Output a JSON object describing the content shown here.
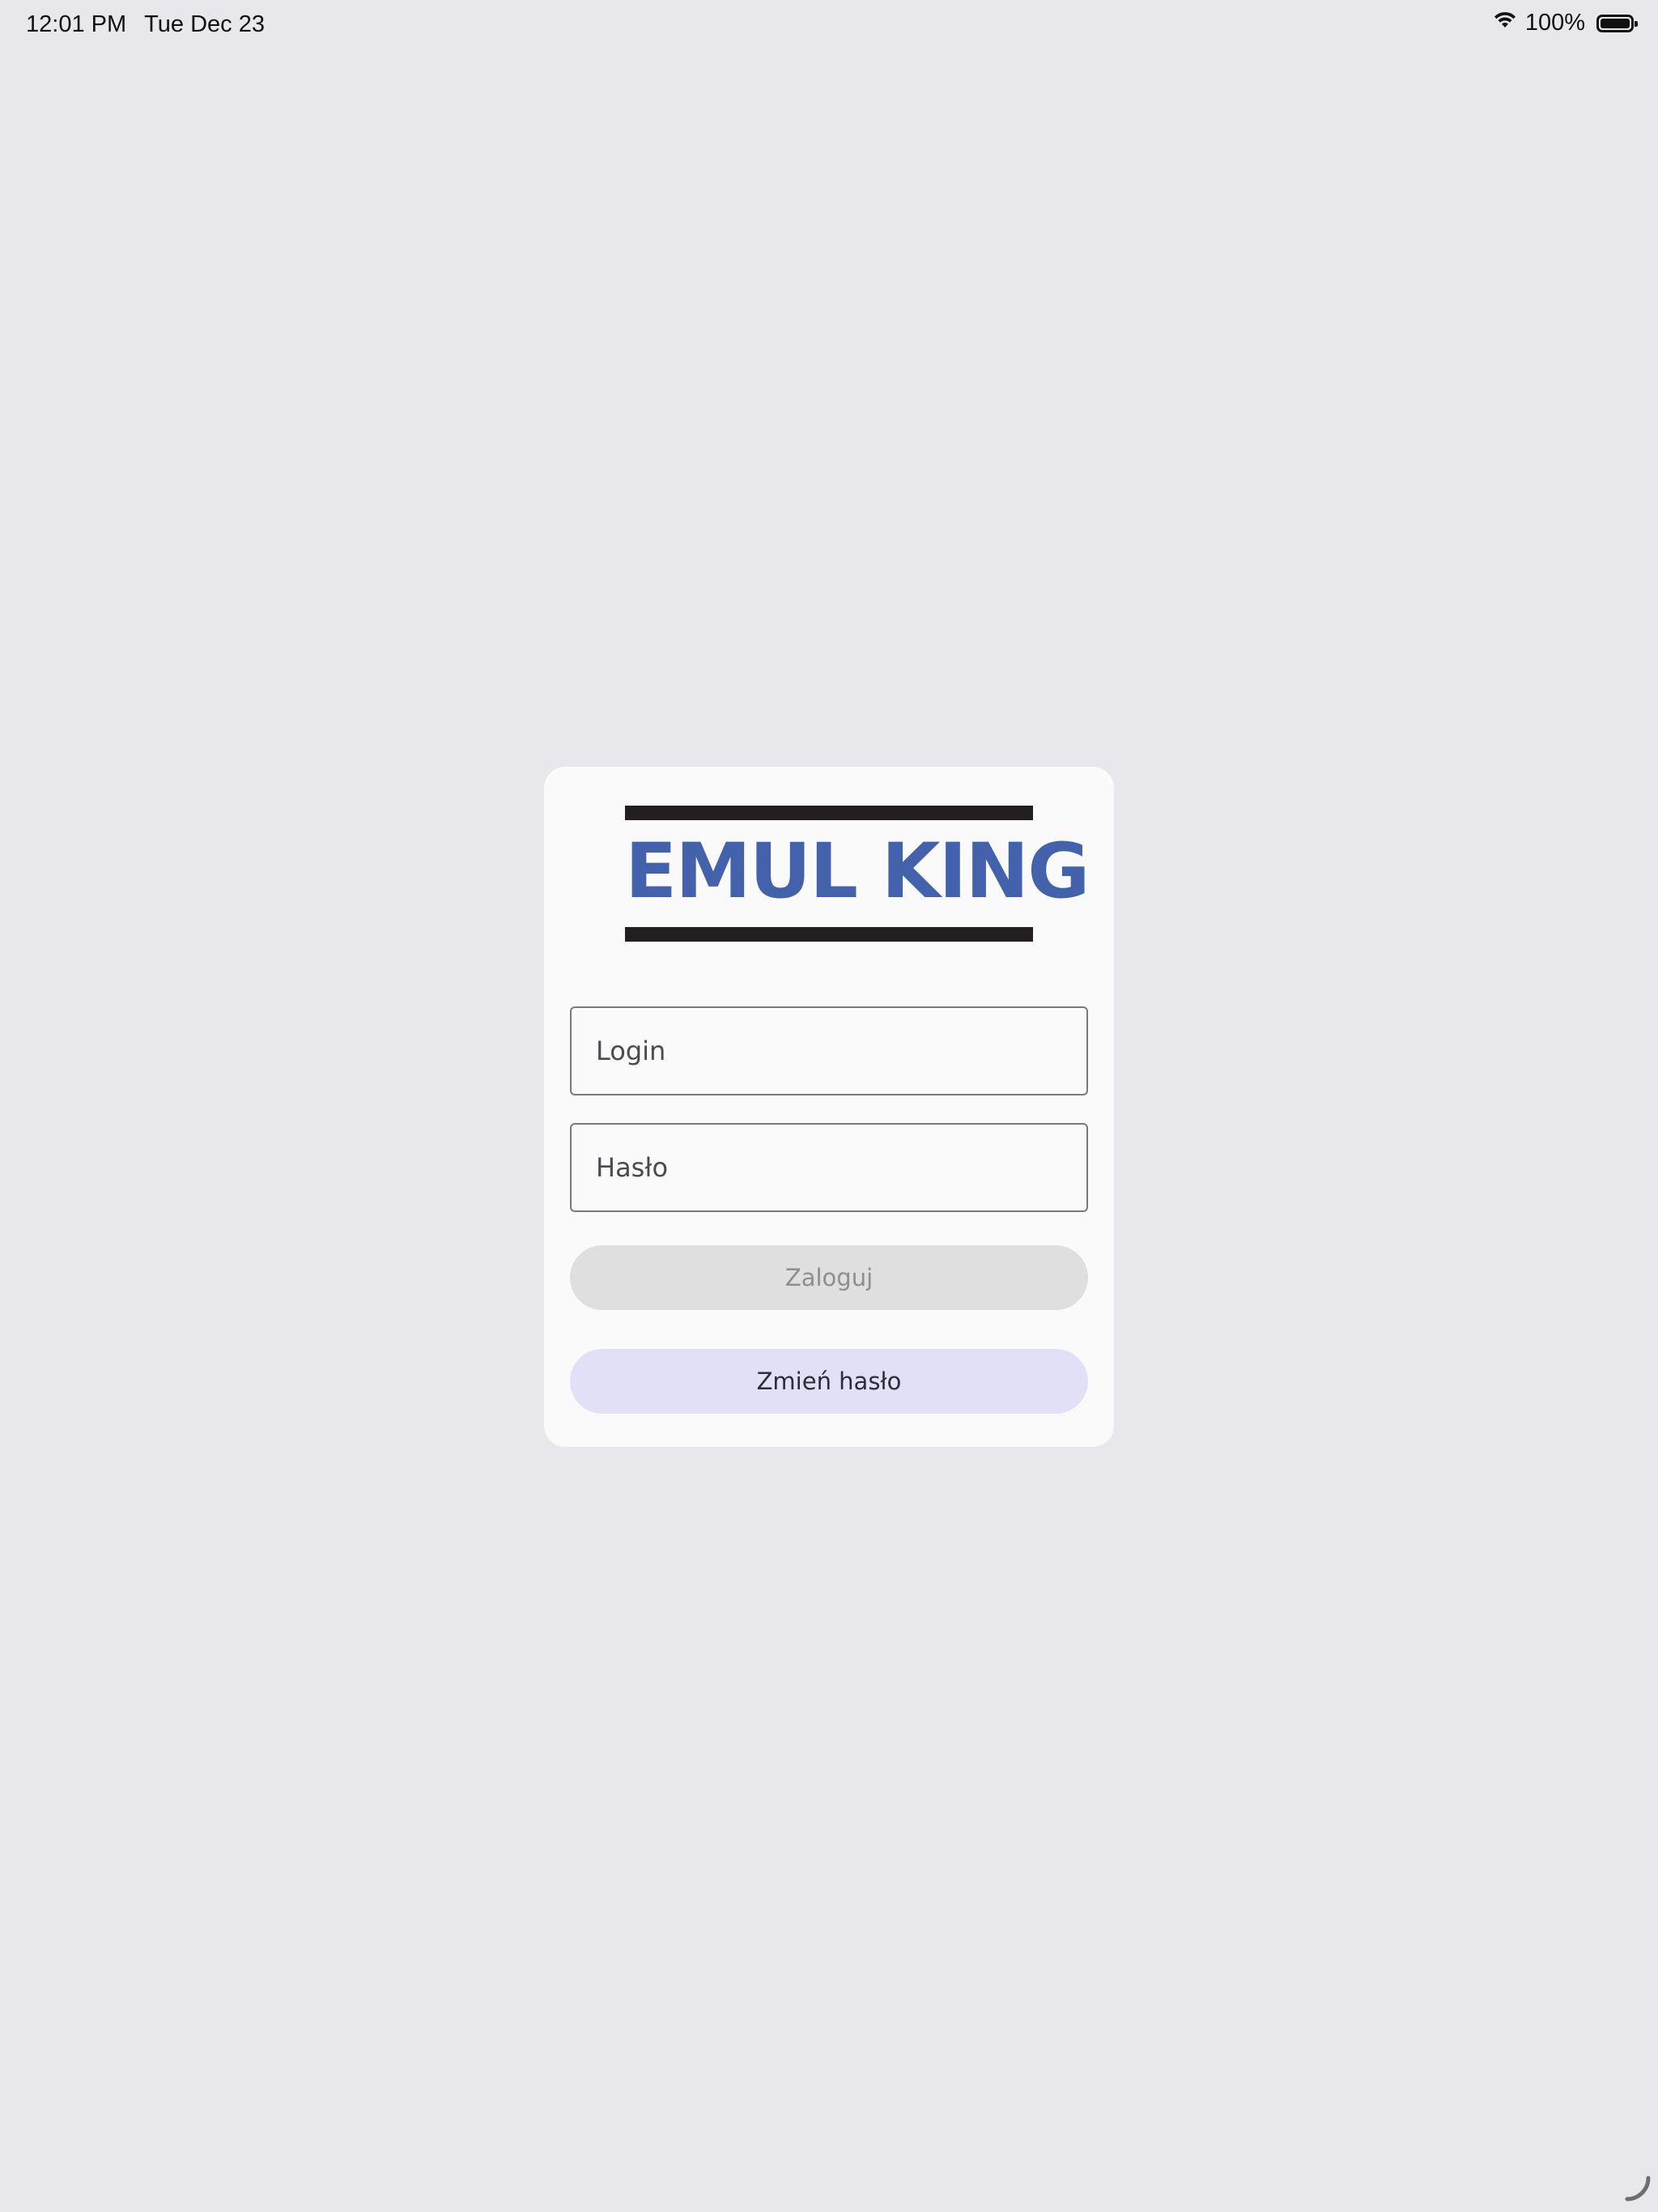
{
  "status_bar": {
    "time": "12:01 PM",
    "date": "Tue Dec 23",
    "battery_percent": "100%",
    "icons": [
      "wifi-icon",
      "battery-icon"
    ]
  },
  "logo": {
    "text": "EMUL KING",
    "colors": {
      "text": "#4462ab",
      "bars": "#231f20"
    }
  },
  "form": {
    "login_placeholder": "Login",
    "login_value": "",
    "password_placeholder": "Hasło",
    "password_value": "",
    "login_button": "Zaloguj",
    "change_password_button": "Zmień hasło"
  },
  "colors": {
    "background": "#e8e7ec",
    "card": "#fafafa",
    "login_button_bg": "#dfdfdf",
    "change_button_bg": "#e1e0f7"
  }
}
